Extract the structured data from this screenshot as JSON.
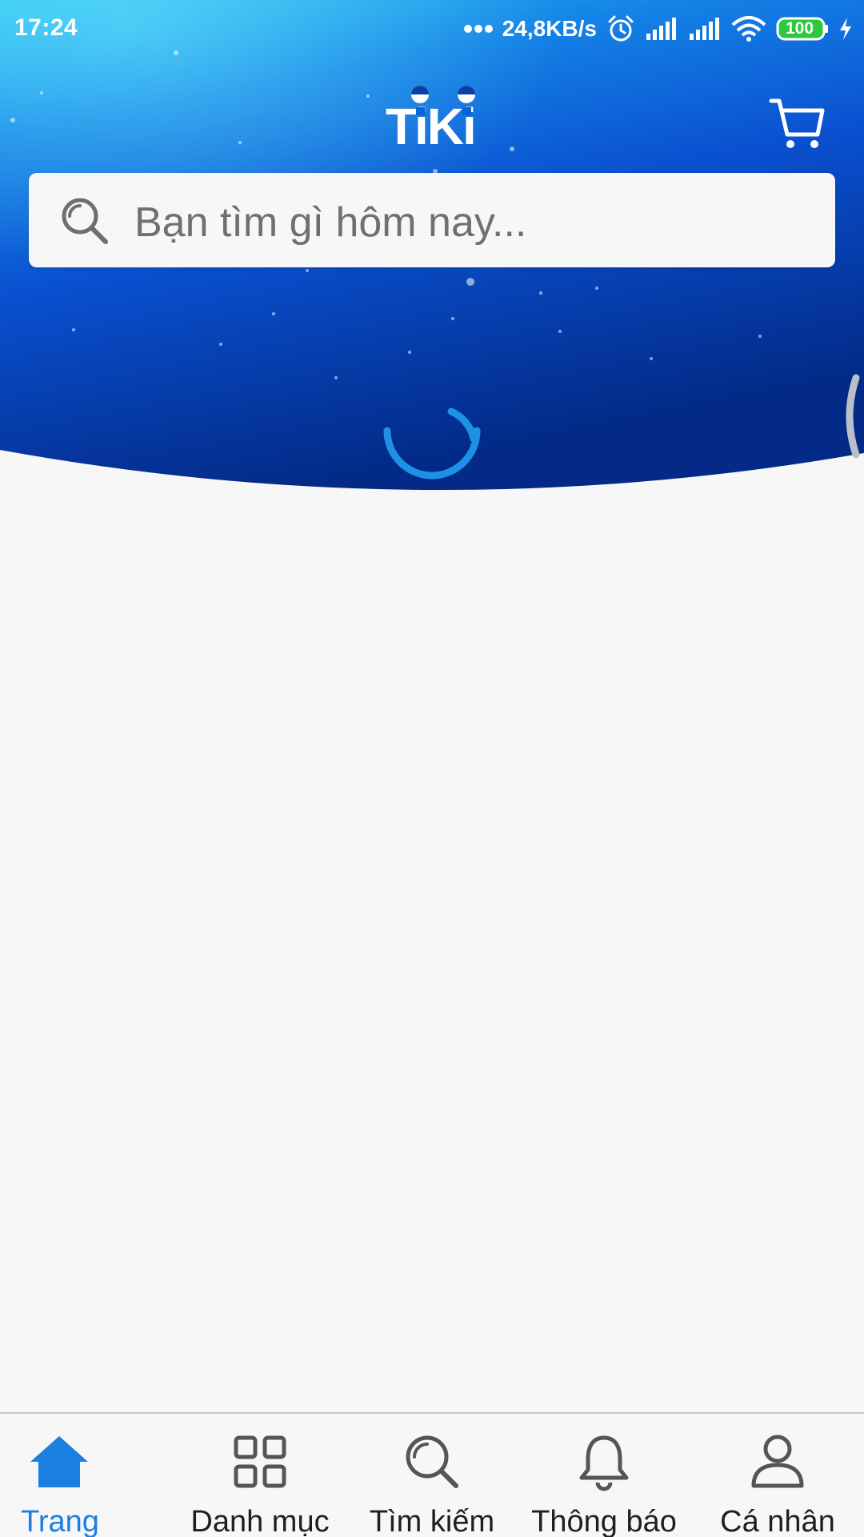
{
  "status_bar": {
    "time": "17:24",
    "network_speed": "24,8KB/s",
    "battery": "100",
    "icons": [
      "more-dots-icon",
      "alarm-icon",
      "signal-icon",
      "signal-icon",
      "wifi-icon",
      "battery-icon",
      "charging-icon"
    ]
  },
  "header": {
    "logo_text": "TiKi",
    "cart_icon": "cart-icon",
    "accent": "#1a7fe0"
  },
  "search": {
    "placeholder": "Bạn tìm gì hôm nay...",
    "icon": "search-icon"
  },
  "loading": {
    "spinner_color": "#1e90e6"
  },
  "bottom_nav": {
    "items": [
      {
        "label": "Trang",
        "icon": "home-icon",
        "active": true
      },
      {
        "label": "Danh mục",
        "icon": "grid-icon",
        "active": false
      },
      {
        "label": "Tìm kiếm",
        "icon": "search-icon",
        "active": false
      },
      {
        "label": "Thông báo",
        "icon": "bell-icon",
        "active": false
      },
      {
        "label": "Cá nhân",
        "icon": "user-icon",
        "active": false
      }
    ]
  },
  "colors": {
    "header_top": "#22b4ee",
    "header_bottom": "#00257a",
    "background": "#f7f7f8",
    "active_nav": "#1a7fe0",
    "inactive_nav": "#333333"
  }
}
